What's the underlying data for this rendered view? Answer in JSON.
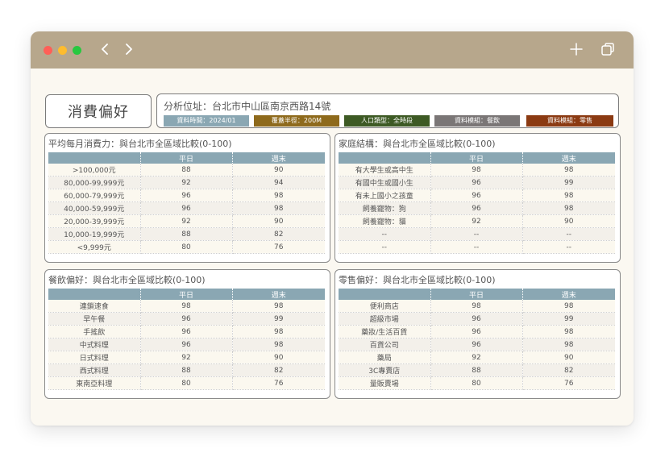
{
  "window": {
    "title_color": "#b7a78c"
  },
  "header": {
    "title": "消費偏好",
    "address": "分析位址：台北市中山區南京西路14號",
    "tags": [
      {
        "label": "資料時間：2024/01",
        "color": "#8aa7b3"
      },
      {
        "label": "覆蓋半徑：200M",
        "color": "#8e6a1c"
      },
      {
        "label": "人口類型：全時段",
        "color": "#3d5a24"
      },
      {
        "label": "資料模組：餐飲",
        "color": "#7a7676"
      },
      {
        "label": "資料模組：零售",
        "color": "#8b3a12"
      }
    ]
  },
  "icons": {
    "back": "chevron-left-icon",
    "forward": "chevron-right-icon",
    "new_tab": "plus-icon",
    "tabs": "tabs-overview-icon"
  },
  "columns": {
    "col1": "",
    "weekday": "平日",
    "weekend": "週末"
  },
  "panels": {
    "spending": {
      "title": "平均每月消費力：與台北市全區域比較(0-100)",
      "rows": [
        [
          ">100,000元",
          "88",
          "90"
        ],
        [
          "80,000-99,999元",
          "92",
          "94"
        ],
        [
          "60,000-79,999元",
          "96",
          "98"
        ],
        [
          "40,000-59,999元",
          "96",
          "98"
        ],
        [
          "20,000-39,999元",
          "92",
          "90"
        ],
        [
          "10,000-19,999元",
          "88",
          "82"
        ],
        [
          "<9,999元",
          "80",
          "76"
        ]
      ]
    },
    "family": {
      "title": "家庭結構：與台北市全區域比較(0-100)",
      "rows": [
        [
          "有大學生或高中生",
          "98",
          "98"
        ],
        [
          "有國中生或國小生",
          "96",
          "99"
        ],
        [
          "有未上國小之孩童",
          "96",
          "98"
        ],
        [
          "飼養寵物：狗",
          "96",
          "98"
        ],
        [
          "飼養寵物：貓",
          "92",
          "90"
        ],
        [
          "--",
          "--",
          "--"
        ],
        [
          "--",
          "--",
          "--"
        ]
      ]
    },
    "dining": {
      "title": "餐飲偏好：與台北市全區域比較(0-100)",
      "rows": [
        [
          "連鎖速食",
          "98",
          "98"
        ],
        [
          "早午餐",
          "96",
          "99"
        ],
        [
          "手搖飲",
          "96",
          "98"
        ],
        [
          "中式料理",
          "96",
          "98"
        ],
        [
          "日式料理",
          "92",
          "90"
        ],
        [
          "西式料理",
          "88",
          "82"
        ],
        [
          "東南亞料理",
          "80",
          "76"
        ]
      ]
    },
    "retail": {
      "title": "零售偏好：與台北市全區域比較(0-100)",
      "rows": [
        [
          "便利商店",
          "98",
          "98"
        ],
        [
          "超級市場",
          "96",
          "99"
        ],
        [
          "藥妝/生活百貨",
          "96",
          "98"
        ],
        [
          "百貨公司",
          "96",
          "98"
        ],
        [
          "藥局",
          "92",
          "90"
        ],
        [
          "3C專賣店",
          "88",
          "82"
        ],
        [
          "量販賣場",
          "80",
          "76"
        ]
      ]
    }
  }
}
